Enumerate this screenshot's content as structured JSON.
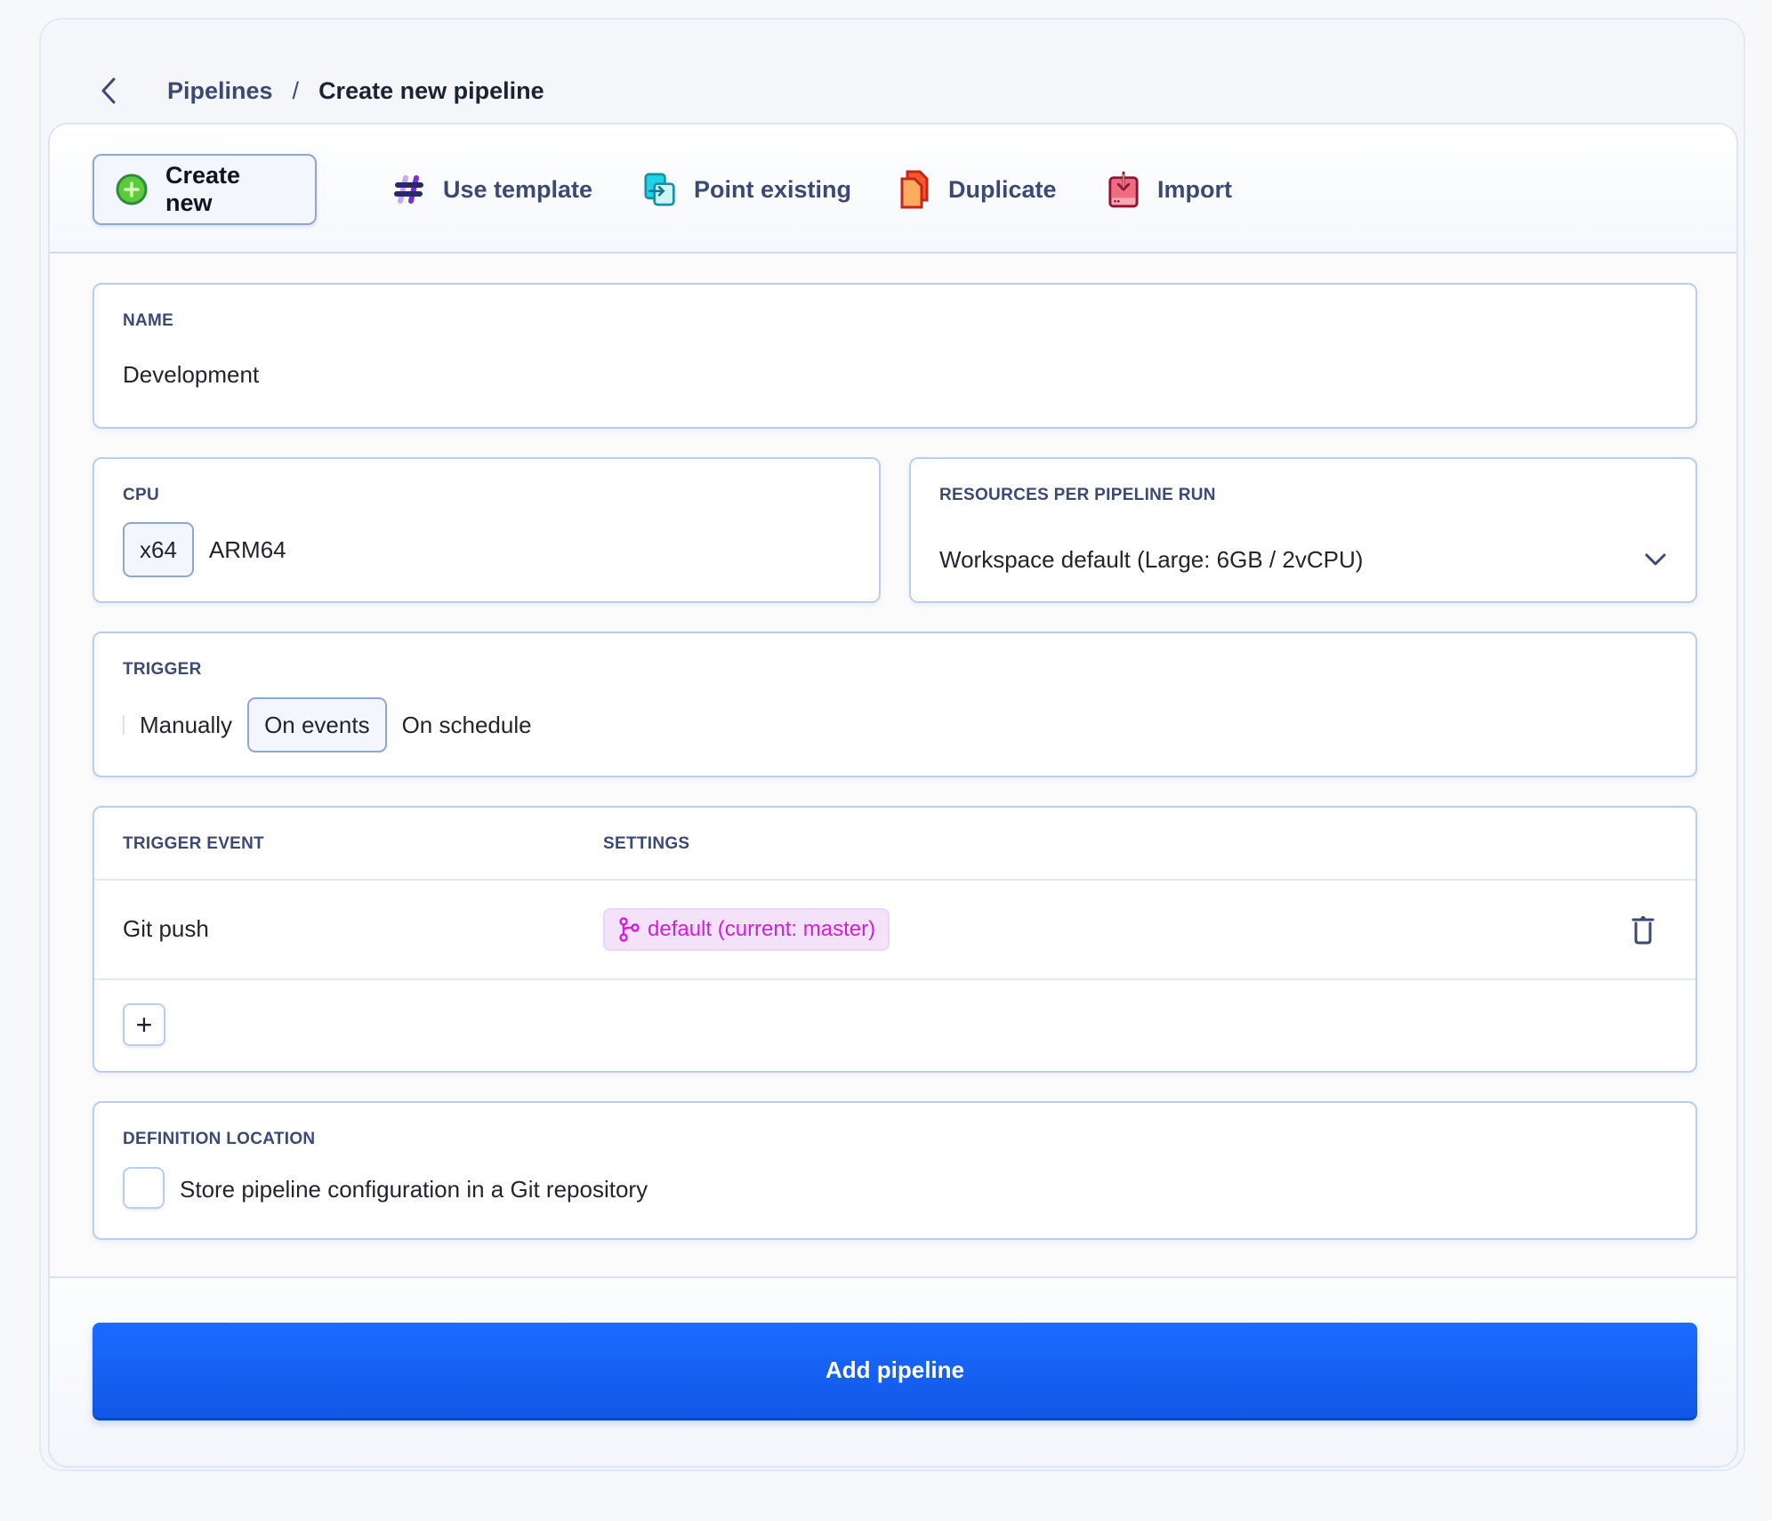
{
  "breadcrumb": {
    "parent": "Pipelines",
    "separator": "/",
    "current": "Create new pipeline"
  },
  "tabs": [
    {
      "label": "Create new",
      "icon": "plus-circle-icon",
      "active": true
    },
    {
      "label": "Use template",
      "icon": "hashtag-icon",
      "active": false
    },
    {
      "label": "Point existing",
      "icon": "point-existing-icon",
      "active": false
    },
    {
      "label": "Duplicate",
      "icon": "duplicate-icon",
      "active": false
    },
    {
      "label": "Import",
      "icon": "import-icon",
      "active": false
    }
  ],
  "name": {
    "label": "NAME",
    "value": "Development"
  },
  "cpu": {
    "label": "CPU",
    "options": [
      "x64",
      "ARM64"
    ],
    "selected": "x64"
  },
  "resources": {
    "label": "RESOURCES PER PIPELINE RUN",
    "value": "Workspace default (Large: 6GB / 2vCPU)"
  },
  "trigger": {
    "label": "TRIGGER",
    "options": [
      "Manually",
      "On events",
      "On schedule"
    ],
    "selected": "On events"
  },
  "trigger_events": {
    "columns": [
      "TRIGGER EVENT",
      "SETTINGS"
    ],
    "rows": [
      {
        "event": "Git push",
        "settings": "default (current: master)"
      }
    ],
    "add_label": "+"
  },
  "definition": {
    "label": "DEFINITION LOCATION",
    "checkbox_label": "Store pipeline configuration in a Git repository",
    "checked": false
  },
  "submit": {
    "label": "Add pipeline"
  },
  "colors": {
    "primary": "#1a6bff",
    "branch_badge_text": "#d21fd6",
    "branch_badge_bg": "#f4e2fa",
    "label_text": "#3c4a72"
  }
}
